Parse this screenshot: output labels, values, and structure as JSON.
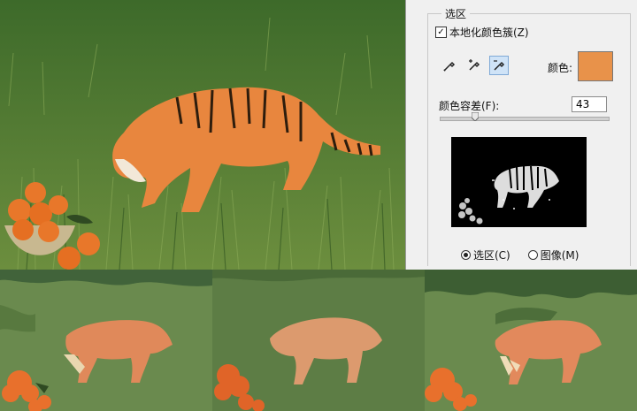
{
  "panel": {
    "group_title": "选区",
    "localized_checkbox_label": "本地化颜色簇(Z)",
    "localized_checked": true,
    "color_label": "颜色:",
    "color_swatch": "#e8924a",
    "tolerance_label": "颜色容差(F):",
    "tolerance_value": "43",
    "tolerance_fraction": 0.21,
    "radio_selection": "选区(C)",
    "radio_image": "图像(M)",
    "selected_radio": "selection",
    "droppers": [
      "eyedropper-icon",
      "eyedropper-plus-icon",
      "eyedropper-minus-icon"
    ]
  },
  "colors": {
    "panel_bg": "#f0f0f0",
    "grass": "#5d7a45",
    "tiger_orange": "#e89060",
    "orange_fruit": "#e86a2a"
  }
}
